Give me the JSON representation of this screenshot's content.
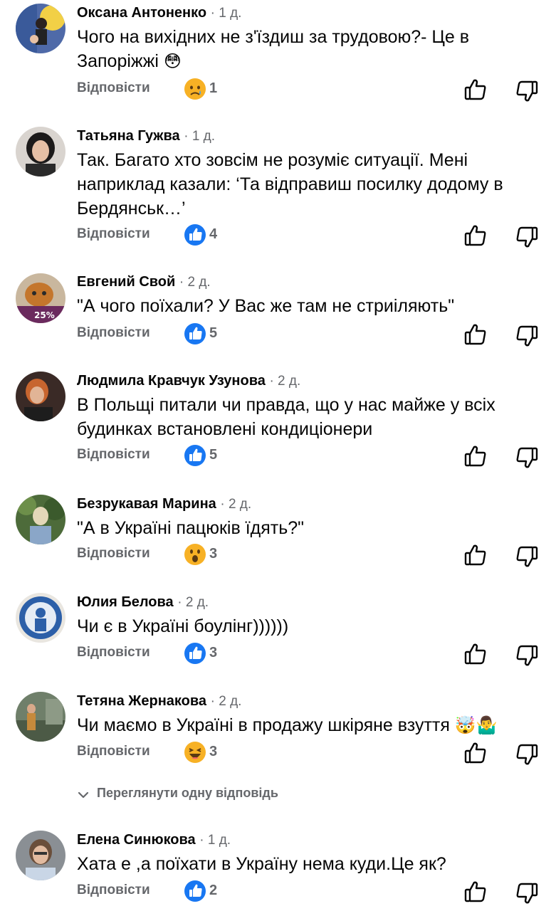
{
  "comments": [
    {
      "author": "Оксана Антоненко",
      "time": "1 д.",
      "text": "Чого на вихідних не з'їздиш за трудовою?- Це в Запоріжжі",
      "emoji": "😳",
      "reply": "Відповісти",
      "reaction": "sad",
      "count": "1"
    },
    {
      "author": "Татьяна Гужва",
      "time": "1 д.",
      "text": "Так. Багато хто зовсім не розуміє ситуації.  Мені наприклад казали: ‘Та відправиш посилку додому в Бердянськ…’",
      "emoji": "",
      "reply": "Відповісти",
      "reaction": "like",
      "count": "4"
    },
    {
      "author": "Евгений Свой",
      "time": "2 д.",
      "text": "\"А чого поїхали? У Вас же там не стриіляють\"",
      "emoji": "",
      "reply": "Відповісти",
      "reaction": "like",
      "count": "5",
      "avatar_badge": "25%"
    },
    {
      "author": "Людмила Кравчук Узунова",
      "time": "2 д.",
      "text": "В Польщі питали чи правда, що у нас майже у всіх будинках встановлені кондиціонери",
      "emoji": "",
      "reply": "Відповісти",
      "reaction": "like",
      "count": "5"
    },
    {
      "author": "Безрукавая Марина",
      "time": "2 д.",
      "text": "\"А в Україні пацюків їдять?\"",
      "emoji": "",
      "reply": "Відповісти",
      "reaction": "wow",
      "count": "3"
    },
    {
      "author": "Юлия Белова",
      "time": "2 д.",
      "text": "Чи є в Україні боулінг))))))",
      "emoji": "",
      "reply": "Відповісти",
      "reaction": "like",
      "count": "3"
    },
    {
      "author": "Тетяна Жернакова",
      "time": "2 д.",
      "text": "Чи маємо в Україні в продажу шкіряне взуття",
      "emoji": "🤯🤷‍♂️",
      "reply": "Відповісти",
      "reaction": "haha",
      "count": "3"
    },
    {
      "author": "Елена Синюкова",
      "time": "1 д.",
      "text": "Хата е ,а поїхати в Україну нема куди.Це як?",
      "emoji": "",
      "reply": "Відповісти",
      "reaction": "like",
      "count": "2"
    }
  ],
  "view_replies": "Переглянути одну відповідь",
  "colors": {
    "like_blue": "#1877f2",
    "secondary": "#65676b",
    "text": "#050505",
    "emoji_yellow": "#f7b125"
  },
  "icons": {
    "like": "thumbs-up-icon",
    "dislike": "thumbs-down-icon",
    "chevron": "chevron-down-icon"
  }
}
